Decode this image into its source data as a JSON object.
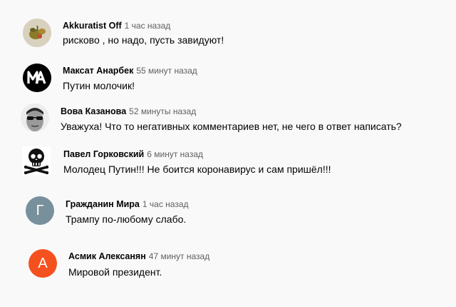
{
  "comments": [
    {
      "author": "Akkuratist Off",
      "time": "1 час назад",
      "text": "рисково , но надо,  пусть завидуют!",
      "avatar": {
        "type": "image",
        "icon": "fruit-photo-avatar"
      }
    },
    {
      "author": "Максат Анарбек",
      "time": "55 минут назад",
      "text": "Путин молочик!",
      "avatar": {
        "type": "logo",
        "icon": "ma-logo-avatar",
        "color": "#000000"
      }
    },
    {
      "author": "Вова Казанова",
      "time": "52 минуты назад",
      "text": "Уважуха! Что то негативных комментариев нет, не чего в ответ написать?",
      "avatar": {
        "type": "image",
        "icon": "man-sunglasses-avatar"
      }
    },
    {
      "author": "Павел Горковский",
      "time": "6 минут назад",
      "text": "Молодец Путин!!! Не боится коронавирус и сам пришёл!!!",
      "avatar": {
        "type": "image",
        "icon": "skull-crossbones-avatar"
      }
    },
    {
      "author": "Гражданин Мира",
      "time": "1 час назад",
      "text": "Трампу по-любому слабо.",
      "avatar": {
        "type": "letter",
        "letter": "Г",
        "color": "#78909c"
      }
    },
    {
      "author": "Асмик Алексанян",
      "time": "47 минут назад",
      "text": "Мировой президент.",
      "avatar": {
        "type": "letter",
        "letter": "А",
        "color": "#f4511e"
      }
    }
  ]
}
